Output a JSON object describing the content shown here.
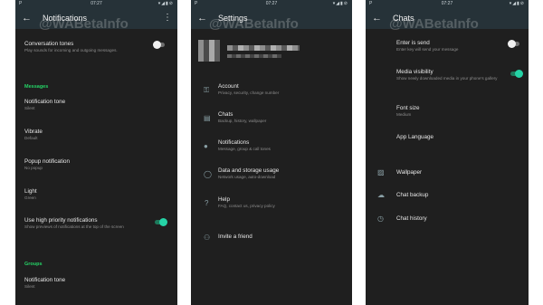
{
  "watermark": "@WABetaInfo",
  "status": {
    "time": "07:27",
    "left_icon": "P",
    "right_icons": "▾◢▮⊘"
  },
  "screen1": {
    "title": "Notifications",
    "back_icon": "←",
    "more_icon": "⋮",
    "conversation_tones": {
      "title": "Conversation tones",
      "subtitle": "Play sounds for incoming and outgoing messages."
    },
    "section_messages": "Messages",
    "notification_tone": {
      "title": "Notification tone",
      "subtitle": "Silent"
    },
    "vibrate": {
      "title": "Vibrate",
      "subtitle": "Default"
    },
    "popup": {
      "title": "Popup notification",
      "subtitle": "No popup"
    },
    "light": {
      "title": "Light",
      "subtitle": "Green"
    },
    "high_priority": {
      "title": "Use high priority notifications",
      "subtitle": "Show previews of notifications at the top of the screen"
    },
    "section_groups": "Groups",
    "group_tone": {
      "title": "Notification tone",
      "subtitle": "Silent"
    }
  },
  "screen2": {
    "title": "Settings",
    "back_icon": "←",
    "items": [
      {
        "icon": "⚿",
        "title": "Account",
        "subtitle": "Privacy, security, change number"
      },
      {
        "icon": "▤",
        "title": "Chats",
        "subtitle": "Backup, history, wallpaper"
      },
      {
        "icon": "●",
        "title": "Notifications",
        "subtitle": "Message, group & call tones"
      },
      {
        "icon": "◯",
        "title": "Data and storage usage",
        "subtitle": "Network usage, auto-download"
      },
      {
        "icon": "?",
        "title": "Help",
        "subtitle": "FAQ, contact us, privacy policy"
      },
      {
        "icon": "⚇",
        "title": "Invite a friend",
        "subtitle": ""
      }
    ]
  },
  "screen3": {
    "title": "Chats",
    "back_icon": "←",
    "enter_is_send": {
      "title": "Enter is send",
      "subtitle": "Enter key will send your message"
    },
    "media_visibility": {
      "title": "Media visibility",
      "subtitle": "Show newly downloaded media in your phone's gallery"
    },
    "font_size": {
      "title": "Font size",
      "subtitle": "Medium"
    },
    "app_language": {
      "title": "App Language"
    },
    "wallpaper": {
      "icon": "▨",
      "title": "Wallpaper"
    },
    "chat_backup": {
      "icon": "☁",
      "title": "Chat backup"
    },
    "chat_history": {
      "icon": "◷",
      "title": "Chat history"
    }
  },
  "colors": {
    "accent": "#25d366",
    "toolbar": "#263238",
    "background": "#1f1f1f"
  }
}
